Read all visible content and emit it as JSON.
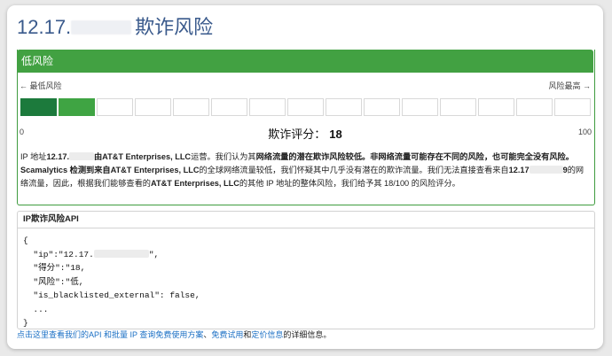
{
  "title": {
    "prefix": "12.17.",
    "suffix": "欺诈风险"
  },
  "risk": {
    "label": "低风险",
    "scale_left": "← 最低风险",
    "scale_right": "风险最高 →",
    "min": "0",
    "max": "100",
    "score_label": "欺诈评分：",
    "score": "18",
    "score_fraction": 0.18,
    "filled_segments": 2,
    "total_segments": 15,
    "color_dark": "#1c7a3c",
    "color_light": "#3fa443",
    "header_color": "#42a142"
  },
  "description": {
    "p1_a": "IP 地址",
    "ip_prefix": "12.17.",
    "p1_b": "由AT&T Enterprises, LLC",
    "p1_c": "运营。我们认为其",
    "p1_d": "网络流量的潜在欺诈风险较低。非网络流量可能存在不同的风险，也可能完全没有风险。",
    "p2_a": "Scamalytics 检测到来自AT&T Enterprises, LLC",
    "p2_b": "的全球网络流量较低，我们怀疑其中几乎没有潜在的欺诈流量。我们无法直接查看来自",
    "ip2_prefix": "12.17",
    "ip2_suffix": "9",
    "p2_c": "的网络流量，因此，根据我们能够查看的",
    "p2_d": "AT&T Enterprises, LLC",
    "p2_e": "的其他 IP 地址的整体风险，我们给予其 18/100 的风险评分。"
  },
  "api": {
    "heading": "IP欺诈风险API",
    "open": "{",
    "ip_key": "  \"ip\":\"12.17.",
    "ip_end": "\",",
    "score_line": "  \"得分\":\"18,",
    "risk_line": "  \"风险\":\"低,",
    "blacklist_line": "  \"is_blacklisted_external\": false,",
    "ellipsis": "  ...",
    "close": "}"
  },
  "footer": {
    "link1": "点击这里查看我们的API 和批量 IP 查询免费使用方案",
    "sep1": "、",
    "link2": "免费试用",
    "sep2": "和",
    "link3": "定价信息",
    "tail": "的详细信息。"
  }
}
